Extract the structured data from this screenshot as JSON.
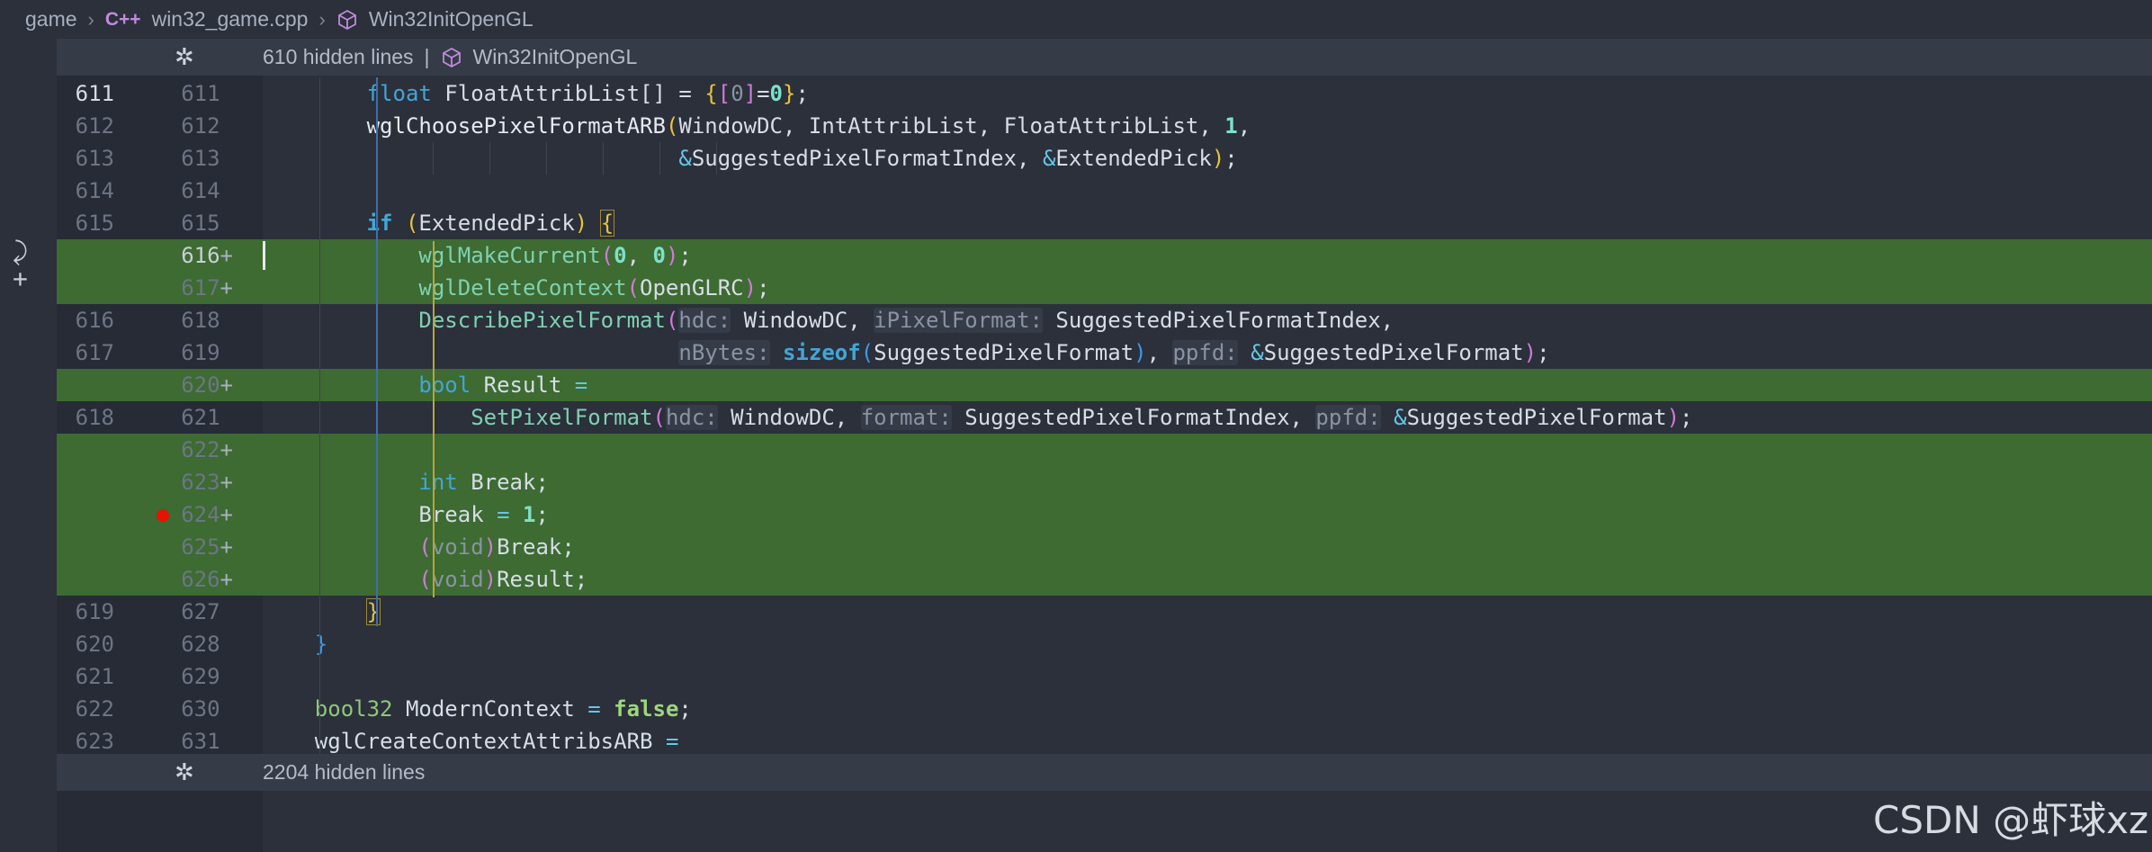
{
  "breadcrumb": {
    "items": [
      "game",
      "win32_game.cpp",
      "Win32InitOpenGL"
    ],
    "cpp_icon": "C++"
  },
  "hidden_top": {
    "label": "610 hidden lines",
    "separator": "|",
    "symbol": "Win32InitOpenGL"
  },
  "hidden_bottom": {
    "label": "2204 hidden lines"
  },
  "gutter": {
    "old": [
      "611",
      "612",
      "613",
      "614",
      "615",
      "",
      "",
      "616",
      "617",
      "",
      "618",
      "",
      "",
      "",
      "",
      "",
      "619",
      "620",
      "621",
      "622",
      "623"
    ],
    "new": [
      "611",
      "612",
      "613",
      "614",
      "615",
      "616",
      "617",
      "618",
      "619",
      "620",
      "621",
      "622",
      "623",
      "624",
      "625",
      "626",
      "627",
      "628",
      "629",
      "630",
      "631"
    ],
    "plus": "+"
  },
  "watermark": "CSDN @虾球xz",
  "colors": {
    "added_line": "#3d6b32",
    "breakpoint": "#e51400",
    "keyword": "#41a6d9"
  }
}
